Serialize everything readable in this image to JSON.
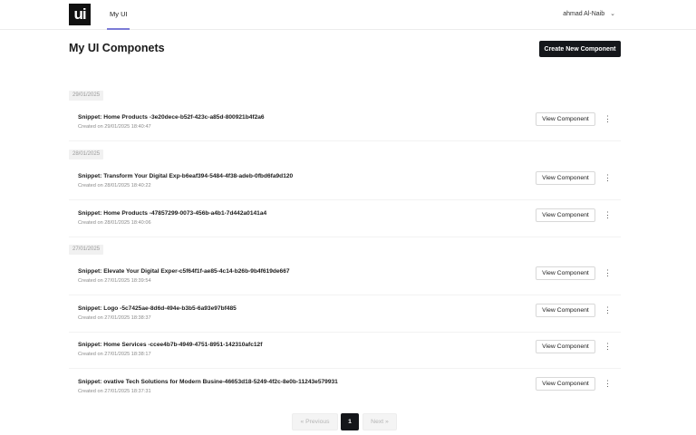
{
  "header": {
    "logo_text": "ui",
    "nav_tab": "My UI",
    "user_name": "ahmad Al-Naib",
    "user_chevron": "⌄"
  },
  "main": {
    "title": "My UI Componets",
    "create_button": "Create New Component",
    "view_button_label": "View Component",
    "menu_glyph": "⋮"
  },
  "groups": [
    {
      "date": "29/01/2025",
      "items": [
        {
          "title": "Snippet: Home Products -3e20dece-b52f-423c-a85d-800921b4f2a6",
          "created": "Created on 29/01/2025 18:40:47"
        }
      ]
    },
    {
      "date": "28/01/2025",
      "items": [
        {
          "title": "Snippet: Transform Your Digital Exp-b6eaf394-5484-4f38-adeb-0fbd6fa9d120",
          "created": "Created on 28/01/2025 18:40:22"
        },
        {
          "title": "Snippet: Home Products -47857299-0073-456b-a4b1-7d442a0141a4",
          "created": "Created on 28/01/2025 18:40:06"
        }
      ]
    },
    {
      "date": "27/01/2025",
      "items": [
        {
          "title": "Snippet: Elevate Your Digital Exper-c5f64f1f-ae85-4c14-b26b-9b4f619de667",
          "created": "Created on 27/01/2025 18:39:54"
        },
        {
          "title": "Snippet: Logo -5c7425ae-8d6d-494e-b3b5-6a93e97bf485",
          "created": "Created on 27/01/2025 18:38:37"
        },
        {
          "title": "Snippet: Home Services -ccee4b7b-4949-4751-8951-142310afc12f",
          "created": "Created on 27/01/2025 18:38:17"
        },
        {
          "title": "Snippet: ovative Tech Solutions for Modern Busine-46653d18-5249-4f2c-8e0b-11243e579931",
          "created": "Created on 27/01/2025 18:37:31"
        }
      ]
    }
  ],
  "pagination": {
    "prev": "« Previous",
    "current": "1",
    "next": "Next »"
  },
  "colors": {
    "primary_button": "#15171b",
    "nav_underline": "#7b7bd6"
  }
}
